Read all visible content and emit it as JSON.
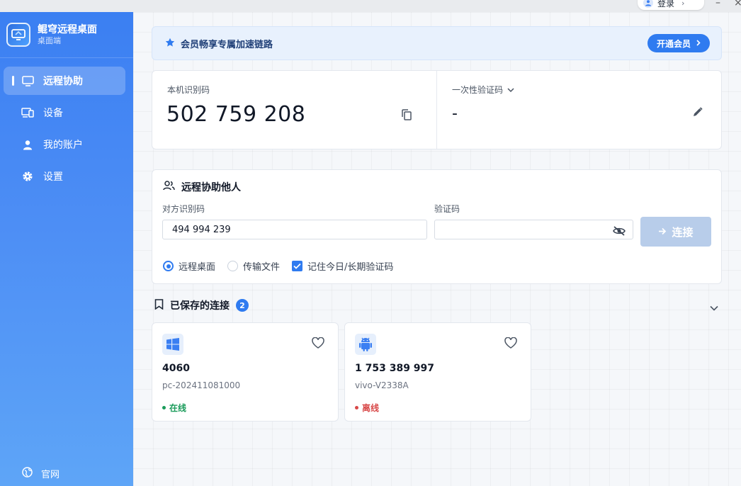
{
  "topbar": {
    "login_label": "登录"
  },
  "app": {
    "title": "鲲穹远程桌面",
    "subtitle": "桌面端"
  },
  "sidebar": {
    "items": [
      {
        "label": "远程协助",
        "icon": "monitor-icon",
        "active": true
      },
      {
        "label": "设备",
        "icon": "devices-icon",
        "active": false
      },
      {
        "label": "我的账户",
        "icon": "user-icon",
        "active": false
      },
      {
        "label": "设置",
        "icon": "gear-icon",
        "active": false
      }
    ],
    "footer_link": "官网"
  },
  "vip": {
    "text": "会员畅享专属加速链路",
    "button": "开通会员"
  },
  "local": {
    "id_label": "本机识别码",
    "id_value": "502 759 208",
    "otp_label": "一次性验证码",
    "otp_value": "-"
  },
  "assist": {
    "title": "远程协助他人",
    "peer_label": "对方识别码",
    "peer_value": "494 994 239",
    "code_label": "验证码",
    "code_value": "",
    "connect_label": "连接",
    "options": {
      "remote_desktop": "远程桌面",
      "file_transfer": "传输文件",
      "remember_code": "记住今日/长期验证码"
    },
    "selected_mode": "远程桌面",
    "remember_checked": true
  },
  "saved": {
    "title": "已保存的连接",
    "count": "2",
    "devices": [
      {
        "name": "4060",
        "host": "pc-202411081000",
        "status": "在线",
        "os_icon": "windows-icon",
        "status_color": "#1a9b5a"
      },
      {
        "name": "1 753 389 997",
        "host": "vivo-V2338A",
        "status": "离线",
        "os_icon": "android-icon",
        "status_color": "#d84848"
      }
    ]
  },
  "colors": {
    "accent": "#2f7bf0",
    "sidebar_top": "#3b7ff2",
    "sidebar_bottom": "#5ea5f7"
  }
}
